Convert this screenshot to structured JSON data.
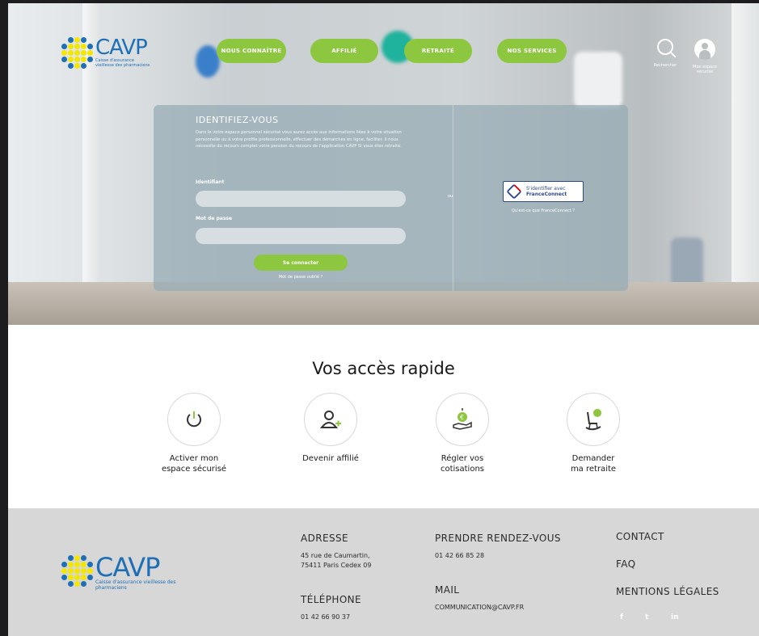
{
  "brand": {
    "name": "CAVP",
    "tagline": "Caisse d'assurance vieillesse des pharmaciens",
    "colors": {
      "blue": "#1e6fb5",
      "green": "#8dc63f",
      "yellow": "#f3e600"
    }
  },
  "nav": {
    "items": [
      {
        "label": "NOUS CONNAÎTRE"
      },
      {
        "label": "AFFILIÉ"
      },
      {
        "label": "RETRAITÉ"
      },
      {
        "label": "NOS SERVICES"
      }
    ],
    "search_label": "Rechercher",
    "account_label": "Mon espace sécurisé",
    "search_icon": "search-icon",
    "account_icon": "user-icon"
  },
  "login": {
    "title": "IDENTIFIEZ-VOUS",
    "description": "Dans le votre espace personnel sécurisé vous aurez accès aux informations liées à votre situation personnelle ou à votre profile professionnelle, effectuer des démarches en ligne, faciliter. Il nous nécessite du recours complet votre pension du recours de l'application CAVP Si vous êtes retraité.",
    "identifier_label": "Identifiant",
    "identifier_value": "",
    "password_label": "Mot de passe",
    "password_value": "",
    "submit_label": "Se connecter",
    "forgot_label": "Mot de passe oublié ?",
    "or_label": "ou",
    "franceconnect_line1": "S'identifier avec",
    "franceconnect_line2": "FranceConnect",
    "franceconnect_info": "Qu'est-ce que FranceConnect ?"
  },
  "quick_access": {
    "title": "Vos accès rapide",
    "items": [
      {
        "label_line1": "Activer mon",
        "label_line2": "espace sécurisé",
        "icon": "power-icon"
      },
      {
        "label_line1": "Devenir affilié",
        "label_line2": "",
        "icon": "user-add-icon"
      },
      {
        "label_line1": "Régler vos",
        "label_line2": "cotisations",
        "icon": "euro-hand-icon"
      },
      {
        "label_line1": "Demander",
        "label_line2": "ma retraite",
        "icon": "rocking-chair-icon"
      }
    ]
  },
  "footer": {
    "address_title": "ADRESSE",
    "address_line1": "45 rue de Caumartin,",
    "address_line2": "75411 Paris Cedex 09",
    "phone_title": "TÉLÉPHONE",
    "phone": "01 42 66 90 37",
    "appointment_title": "PRENDRE RENDEZ-VOUS",
    "appointment_phone": "01 42 66 85 28",
    "mail_title": "MAIL",
    "mail": "COMMUNICATION@CAVP.FR",
    "links": [
      "CONTACT",
      "FAQ",
      "MENTIONS LÉGALES"
    ],
    "social": [
      "f",
      "t",
      "in"
    ]
  }
}
